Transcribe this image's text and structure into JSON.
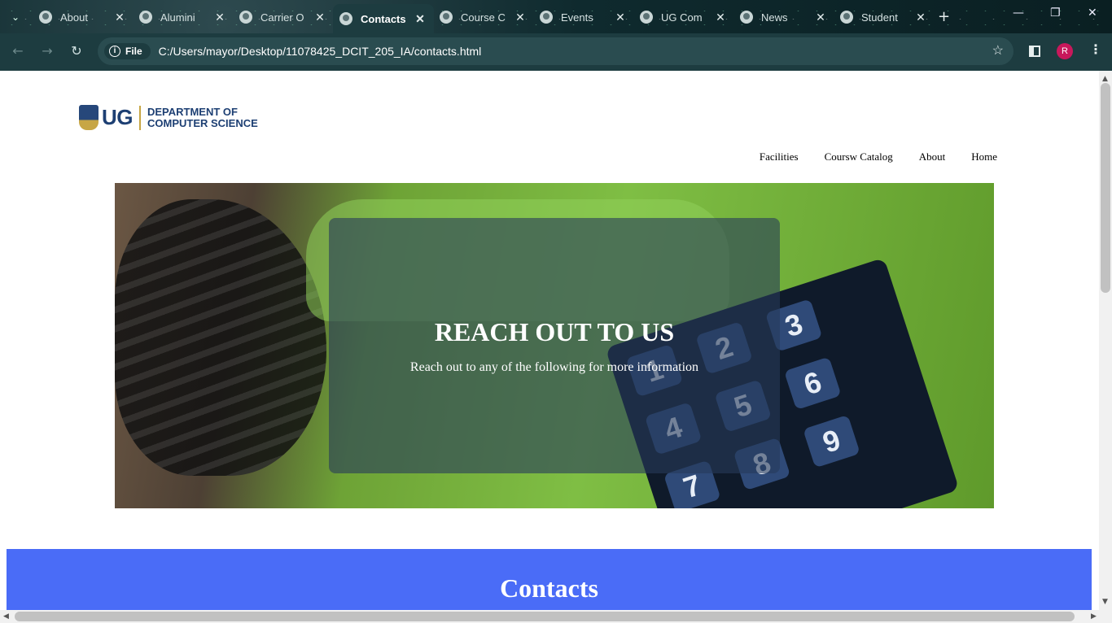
{
  "browser": {
    "tabs": [
      {
        "label": "About",
        "active": false
      },
      {
        "label": "Alumini",
        "active": false
      },
      {
        "label": "Carrier O",
        "active": false
      },
      {
        "label": "Contacts",
        "active": true
      },
      {
        "label": "Course C",
        "active": false
      },
      {
        "label": "Events",
        "active": false
      },
      {
        "label": "UG Com",
        "active": false
      },
      {
        "label": "News",
        "active": false
      },
      {
        "label": "Student",
        "active": false
      }
    ],
    "close_glyph": "✕",
    "new_tab_glyph": "+",
    "chip_label": "File",
    "url": "C:/Users/mayor/Desktop/11078425_DCIT_205_IA/contacts.html",
    "profile_initial": "R",
    "icons": [
      "tab-list-icon",
      "back-icon",
      "forward-icon",
      "reload-icon",
      "info-icon",
      "star-icon",
      "side-panel-icon",
      "menu-icon",
      "minimize-icon",
      "restore-icon",
      "close-window-icon"
    ]
  },
  "page": {
    "logo": {
      "ug": "UG",
      "dept_line1": "DEPARTMENT OF",
      "dept_line2": "COMPUTER SCIENCE"
    },
    "nav": [
      "Facilities",
      "Coursw Catalog",
      "About",
      "Home"
    ],
    "hero": {
      "title": "REACH OUT TO US",
      "subtitle": "Reach out to any of the following for more information",
      "keys": [
        "1",
        "2",
        "3",
        "4",
        "5",
        "6",
        "7",
        "8",
        "9"
      ]
    },
    "section_title": "Contacts"
  },
  "colors": {
    "section_bg": "#4a6cf7",
    "toolbar": "#1d3c40",
    "profile": "#c8185b"
  }
}
